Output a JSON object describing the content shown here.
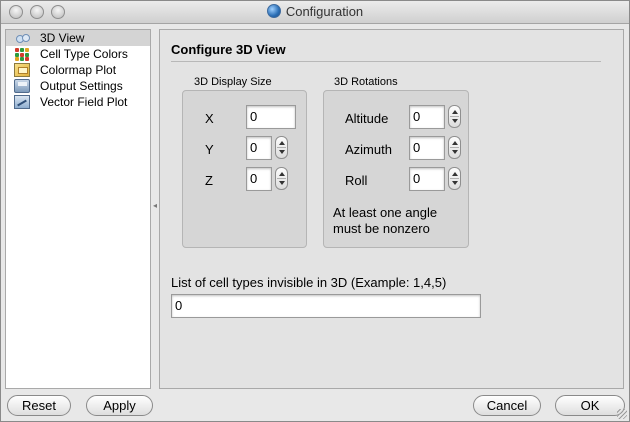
{
  "window": {
    "title": "Configuration"
  },
  "sidebar": {
    "items": [
      {
        "label": "3D View",
        "icon": "cube-icon",
        "selected": true
      },
      {
        "label": "Cell Type Colors",
        "icon": "colored-dots-icon",
        "selected": false
      },
      {
        "label": "Colormap Plot",
        "icon": "colormap-icon",
        "selected": false
      },
      {
        "label": "Output Settings",
        "icon": "disk-icon",
        "selected": false
      },
      {
        "label": "Vector Field Plot",
        "icon": "vector-icon",
        "selected": false
      }
    ]
  },
  "panel": {
    "title": "Configure 3D View",
    "display_size": {
      "label": "3D Display Size",
      "x_label": "X",
      "x_value": "0",
      "y_label": "Y",
      "y_value": "0",
      "z_label": "Z",
      "z_value": "0"
    },
    "rotations": {
      "label": "3D Rotations",
      "altitude_label": "Altitude",
      "altitude_value": "0",
      "azimuth_label": "Azimuth",
      "azimuth_value": "0",
      "roll_label": "Roll",
      "roll_value": "0",
      "note_line1": "At least one angle",
      "note_line2": "must be nonzero"
    },
    "invisible": {
      "label": "List of cell types invisible in 3D (Example: 1,4,5)",
      "value": "0"
    }
  },
  "buttons": {
    "reset": "Reset",
    "apply": "Apply",
    "cancel": "Cancel",
    "ok": "OK"
  }
}
